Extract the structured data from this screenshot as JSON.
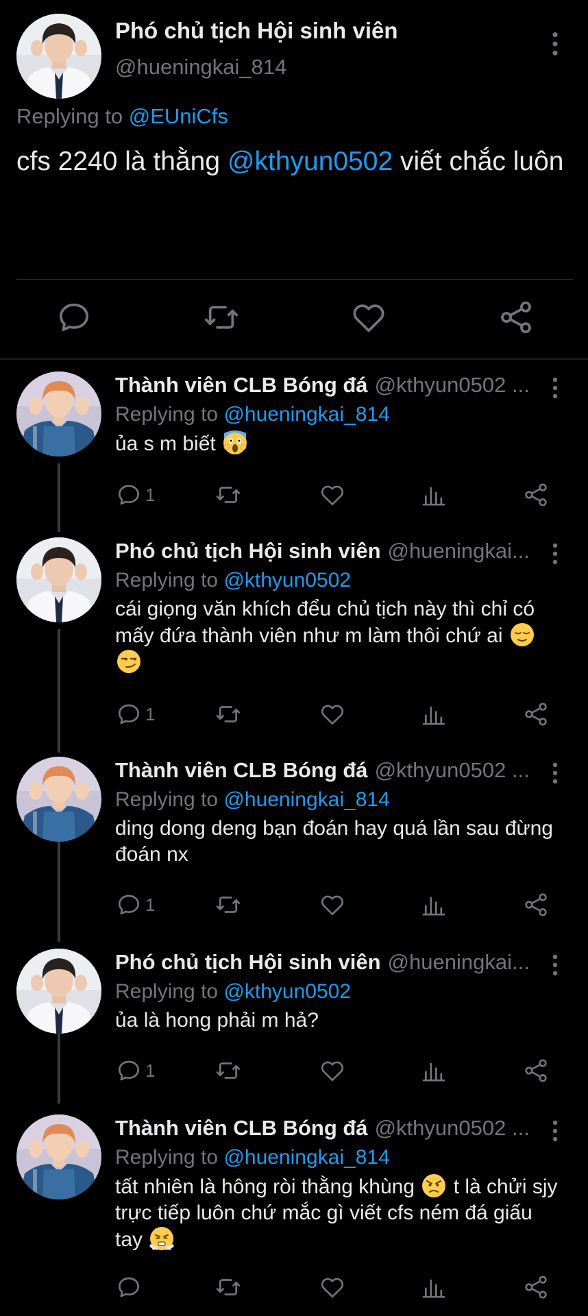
{
  "main_tweet": {
    "name": "Phó chủ tịch Hội sinh viên",
    "handle": "@hueningkai_814",
    "replying_prefix": "Replying to",
    "replying_to": "@EUniCfs",
    "text_before": "cfs 2240 là thằng ",
    "text_mention": "@kthyun0502",
    "text_after": " viết chắc luôn",
    "icons": [
      "reply-icon",
      "retweet-icon",
      "like-icon",
      "share-icon"
    ]
  },
  "replies": [
    {
      "name": "Thành viên CLB Bóng đá",
      "handle": "@kthyun0502 ...",
      "replying_prefix": "Replying to",
      "replying_to": "@hueningkai_814",
      "text": "ủa s m biết",
      "emojis": [
        "face-screaming-in-fear"
      ],
      "reply_count": "1",
      "avatar": "jersey-02"
    },
    {
      "name": "Phó chủ tịch Hội sinh viên",
      "handle": "@hueningkai...",
      "replying_prefix": "Replying to",
      "replying_to": "@kthyun0502",
      "text": "cái giọng văn khích đểu chủ tịch này thì chỉ có mấy đứa thành viên như m làm thôi chứ ai",
      "emojis": [
        "relieved-face",
        "smirking-face"
      ],
      "reply_count": "1",
      "avatar": "white-shirt"
    },
    {
      "name": "Thành viên CLB Bóng đá",
      "handle": "@kthyun0502 ...",
      "replying_prefix": "Replying to",
      "replying_to": "@hueningkai_814",
      "text": "ding dong deng bạn đoán hay quá lần sau đừng đoán nx",
      "emojis": [],
      "reply_count": "1",
      "avatar": "jersey-02"
    },
    {
      "name": "Phó chủ tịch Hội sinh viên",
      "handle": "@hueningkai...",
      "replying_prefix": "Replying to",
      "replying_to": "@kthyun0502",
      "text": "ủa là hong phải m hả?",
      "emojis": [],
      "reply_count": "1",
      "avatar": "white-shirt"
    },
    {
      "name": "Thành viên CLB Bóng đá",
      "handle": "@kthyun0502 ...",
      "replying_prefix": "Replying to",
      "replying_to": "@hueningkai_814",
      "text_part1": "tất nhiên là hông ròi thằng khùng",
      "text_part2": " t là chửi sjy trực tiếp luôn chứ mắc gì viết cfs ném đá giấu tay",
      "emojis": [
        "angry-face",
        "face-with-steam"
      ],
      "reply_count": "",
      "avatar": "jersey-02"
    }
  ],
  "jersey_number": "02",
  "colors": {
    "background": "#000000",
    "text": "#e7e9ea",
    "secondary": "#71767b",
    "link": "#1d9bf0",
    "divider": "#2f3336"
  }
}
